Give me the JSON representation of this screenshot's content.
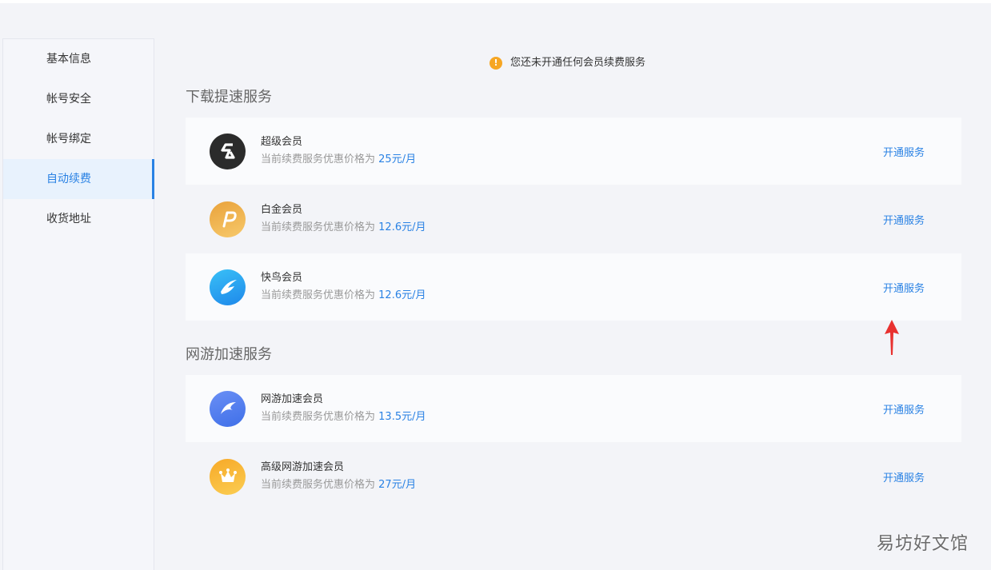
{
  "sidebar": {
    "items": [
      {
        "label": "基本信息"
      },
      {
        "label": "帐号安全"
      },
      {
        "label": "帐号绑定"
      },
      {
        "label": "自动续费",
        "active": true
      },
      {
        "label": "收货地址"
      }
    ]
  },
  "notice": {
    "icon": "warning-icon",
    "icon_glyph": "!",
    "text": "您还未开通任何会员续费服务"
  },
  "sections": [
    {
      "title": "下载提速服务",
      "services": [
        {
          "name": "超级会员",
          "desc_prefix": "当前续费服务优惠价格为",
          "price": "25元/月",
          "button": "开通服务",
          "icon": "super-member-icon",
          "logo_color": "#2b2b2b"
        },
        {
          "name": "白金会员",
          "desc_prefix": "当前续费服务优惠价格为",
          "price": "12.6元/月",
          "button": "开通服务",
          "icon": "platinum-member-icon",
          "logo_color": "#f0b14a"
        },
        {
          "name": "快鸟会员",
          "desc_prefix": "当前续费服务优惠价格为",
          "price": "12.6元/月",
          "button": "开通服务",
          "icon": "kuainiao-member-icon",
          "logo_color": "#2fa8f3"
        }
      ]
    },
    {
      "title": "网游加速服务",
      "services": [
        {
          "name": "网游加速会员",
          "desc_prefix": "当前续费服务优惠价格为",
          "price": "13.5元/月",
          "button": "开通服务",
          "icon": "game-accel-icon",
          "logo_color": "#4a7cf0"
        },
        {
          "name": "高级网游加速会员",
          "desc_prefix": "当前续费服务优惠价格为",
          "price": "27元/月",
          "button": "开通服务",
          "icon": "crown-icon",
          "logo_color": "#f7b733"
        }
      ]
    }
  ],
  "watermark": "易坊好文馆",
  "colors": {
    "accent": "#2a82e4",
    "warning": "#f6a623",
    "arrow": "#e8312f"
  }
}
